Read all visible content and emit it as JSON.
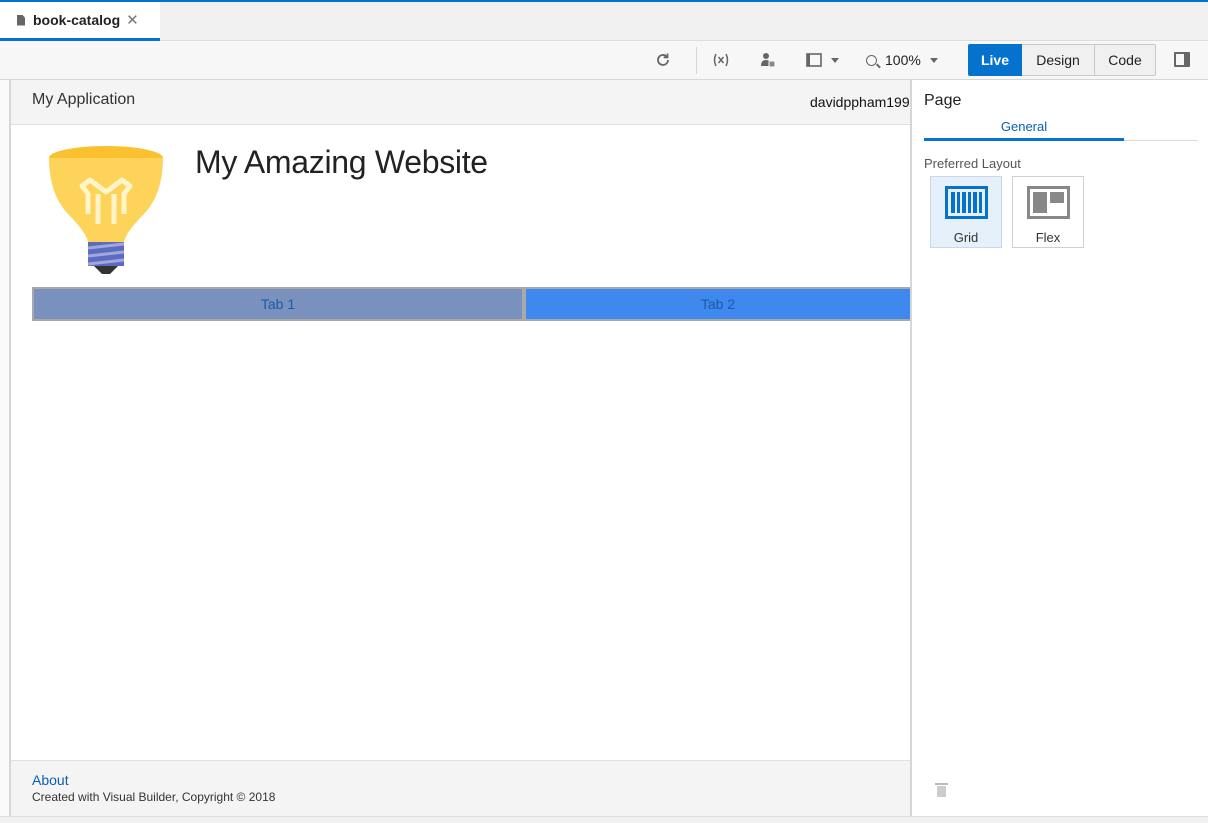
{
  "document_tab": {
    "label": "book-catalog",
    "close_glyph": "✕"
  },
  "toolbar": {
    "zoom": "100%",
    "modes": {
      "live": "Live",
      "design": "Design",
      "code": "Code"
    },
    "active_mode": "Live",
    "accent_color": "#0572ce"
  },
  "app": {
    "title": "My Application",
    "user": "davidppham199",
    "site_title": "My Amazing Website",
    "tabs": [
      {
        "label": "Tab 1"
      },
      {
        "label": "Tab 2"
      }
    ],
    "footer": {
      "link": "About",
      "copyright": "Created with Visual Builder, Copyright © 2018"
    }
  },
  "properties": {
    "title": "Page",
    "tabs": [
      {
        "label": "General"
      }
    ],
    "preferred_layout_label": "Preferred Layout",
    "layouts": [
      {
        "label": "Grid",
        "selected": true
      },
      {
        "label": "Flex",
        "selected": false
      }
    ]
  },
  "icons": [
    "file-icon",
    "close-icon",
    "refresh-icon",
    "variables-icon",
    "user-roles-icon",
    "device-frame-icon",
    "zoom-icon",
    "toggle-panel-icon",
    "lightbulb-logo",
    "trash-icon"
  ]
}
